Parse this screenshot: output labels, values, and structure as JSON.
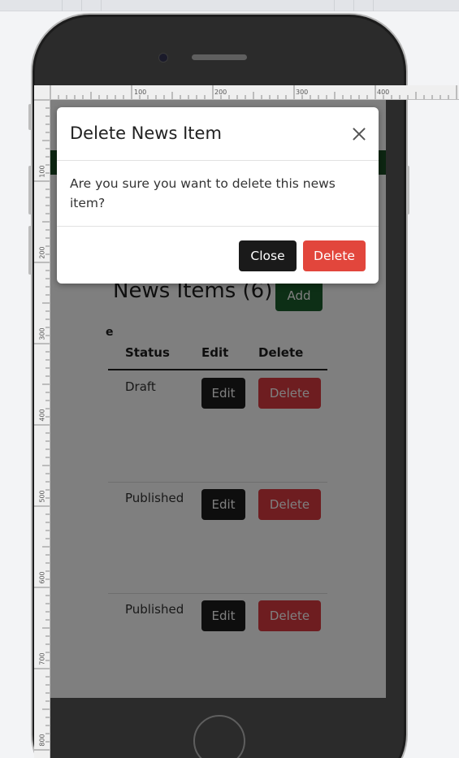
{
  "ruler": {
    "top_labels": [
      "100",
      "200",
      "300",
      "400"
    ],
    "left_labels": [
      "100",
      "200",
      "300",
      "400",
      "500",
      "600",
      "700",
      "800"
    ]
  },
  "page": {
    "heading": "News Items (6)",
    "add_label": "Add",
    "column_fragment": "e",
    "columns": {
      "status": "Status",
      "edit": "Edit",
      "delete": "Delete"
    },
    "rows": [
      {
        "status": "Draft",
        "edit": "Edit",
        "delete": "Delete"
      },
      {
        "status": "Published",
        "edit": "Edit",
        "delete": "Delete"
      },
      {
        "status": "Published",
        "edit": "Edit",
        "delete": "Delete"
      }
    ]
  },
  "modal": {
    "title": "Delete News Item",
    "body": "Are you sure you want to delete this news item?",
    "close_label": "Close",
    "delete_label": "Delete"
  },
  "colors": {
    "header_green": "#1a4d24",
    "add_green": "#1a5e2c",
    "delete_red": "#dc3a40",
    "modal_delete_red": "#e2463c",
    "dark_button": "#1c1c1c"
  }
}
